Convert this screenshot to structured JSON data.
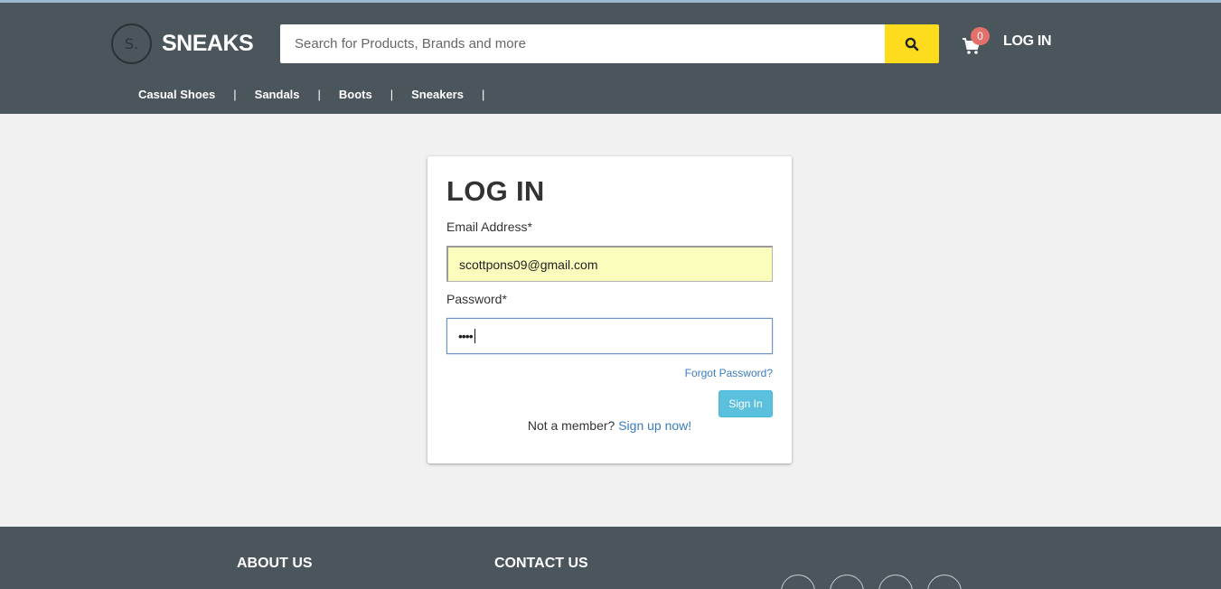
{
  "brand": {
    "logo_mark": "S.",
    "name": "SNEAKS"
  },
  "search": {
    "placeholder": "Search for Products, Brands and more",
    "icon": "search-icon"
  },
  "cart": {
    "icon": "cart-icon",
    "count": "0"
  },
  "header": {
    "login_label": "LOG IN"
  },
  "nav": {
    "items": [
      "Casual Shoes",
      "Sandals",
      "Boots",
      "Sneakers"
    ],
    "separator": "|"
  },
  "login": {
    "title": "LOG IN",
    "email_label": "Email Address*",
    "email_value": "scottpons09@gmail.com",
    "password_label": "Password*",
    "password_value": "••••",
    "forgot_label": "Forgot Password?",
    "signin_label": "Sign In",
    "not_member_text": "Not a member?",
    "signup_label": "Sign up now!"
  },
  "footer": {
    "about_title": "ABOUT US",
    "contact_title": "CONTACT US",
    "social_icons": [
      "facebook-icon",
      "twitter-icon",
      "pinterest-icon",
      "email-icon"
    ]
  },
  "colors": {
    "header_bg": "#4a555c",
    "search_button": "#fcdc1c",
    "badge": "#e3706a",
    "signin_button": "#5bc0de",
    "link": "#3c7bbd",
    "autofill_bg": "#fbfdbc"
  }
}
